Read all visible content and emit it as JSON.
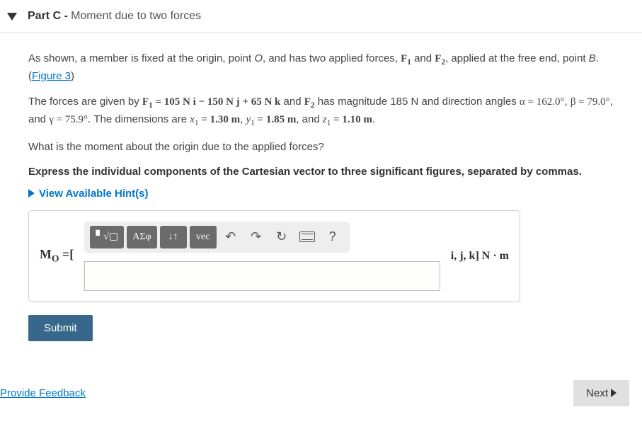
{
  "header": {
    "part_label": "Part C -",
    "part_subtitle": "Moment due to two forces"
  },
  "problem": {
    "intro1": "As shown, a member is fixed at the origin, point ",
    "point_o": "O",
    "intro2": ", and has two applied forces, ",
    "f1": "F",
    "f1_sub": "1",
    "intro3": " and ",
    "f2": "F",
    "f2_sub": "2",
    "intro4": ", applied at the free end, point ",
    "point_b": "B",
    "intro5": ".",
    "figure_link": "Figure 3",
    "forces_intro": "The forces are given by ",
    "f1_eq": "F",
    "eq_text1": " = 105 N i − 150 N j + 65 N k",
    "and1": " and ",
    "f2_text": "F",
    "f2_desc": " has magnitude 185 N and direction angles ",
    "alpha": "α = 162.0°",
    "comma1": ", ",
    "beta": "β = 79.0°",
    "and2": ", and ",
    "gamma": "γ = 75.9°",
    "dims_intro": ". The dimensions are ",
    "x1": "x",
    "x1_sub": "1",
    "x1_val": " = 1.30 m",
    "comma2": ", ",
    "y1": "y",
    "y1_sub": "1",
    "y1_val": " = 1.85 m",
    "and3": ", and ",
    "z1": "z",
    "z1_sub": "1",
    "z1_val": " = 1.10 m",
    "period": ".",
    "question": "What is the moment about the origin due to the applied forces?",
    "instruction": "Express the individual components of the Cartesian vector to three significant figures, separated by commas."
  },
  "hints": {
    "label": "View Available Hint(s)"
  },
  "answer": {
    "label_prefix": "M",
    "label_sub": "O",
    "label_suffix": " =[",
    "units": "i, j, k] N · m",
    "input_value": ""
  },
  "toolbar": {
    "templates": "▘√▢",
    "symbols": "ΑΣφ",
    "scripts": "↓↑",
    "vec": "vec",
    "undo": "↶",
    "redo": "↷",
    "reset": "↻",
    "help": "?"
  },
  "buttons": {
    "submit": "Submit",
    "next": "Next",
    "feedback": "Provide Feedback"
  }
}
